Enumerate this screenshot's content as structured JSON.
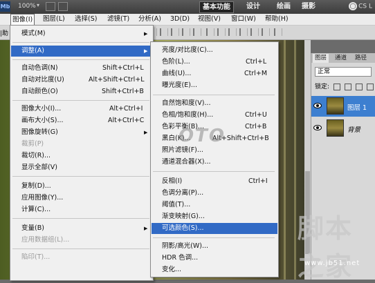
{
  "topbar": {
    "logo": "Mb",
    "zoom": "100%",
    "workspaces": [
      "基本功能",
      "设计",
      "绘画",
      "摄影"
    ],
    "cslive": "CS L"
  },
  "menubar": {
    "items": [
      "图像(I)",
      "图层(L)",
      "选择(S)",
      "滤镜(T)",
      "分析(A)",
      "3D(D)",
      "视图(V)",
      "窗口(W)",
      "帮助(H)"
    ],
    "left_clip": "|助"
  },
  "image_menu": {
    "items": [
      {
        "label": "模式(M)",
        "shortcut": "",
        "arrow": true
      },
      {
        "label": "调整(A)",
        "shortcut": "",
        "arrow": true
      },
      {
        "label": "自动色调(N)",
        "shortcut": "Shift+Ctrl+L"
      },
      {
        "label": "自动对比度(U)",
        "shortcut": "Alt+Shift+Ctrl+L"
      },
      {
        "label": "自动颜色(O)",
        "shortcut": "Shift+Ctrl+B"
      },
      {
        "label": "图像大小(I)...",
        "shortcut": "Alt+Ctrl+I"
      },
      {
        "label": "画布大小(S)...",
        "shortcut": "Alt+Ctrl+C"
      },
      {
        "label": "图像旋转(G)",
        "shortcut": "",
        "arrow": true
      },
      {
        "label": "裁剪(P)",
        "shortcut": "",
        "disabled": true
      },
      {
        "label": "裁切(R)...",
        "shortcut": ""
      },
      {
        "label": "显示全部(V)",
        "shortcut": ""
      },
      {
        "label": "复制(D)...",
        "shortcut": ""
      },
      {
        "label": "应用图像(Y)...",
        "shortcut": ""
      },
      {
        "label": "计算(C)...",
        "shortcut": ""
      },
      {
        "label": "变量(B)",
        "shortcut": "",
        "arrow": true
      },
      {
        "label": "应用数据组(L)...",
        "shortcut": "",
        "disabled": true
      },
      {
        "label": "陷印(T)...",
        "shortcut": "",
        "disabled": true
      }
    ]
  },
  "adjust_menu": {
    "items": [
      {
        "label": "亮度/对比度(C)...",
        "shortcut": ""
      },
      {
        "label": "色阶(L)...",
        "shortcut": "Ctrl+L"
      },
      {
        "label": "曲线(U)...",
        "shortcut": "Ctrl+M"
      },
      {
        "label": "曝光度(E)...",
        "shortcut": ""
      },
      {
        "label": "自然饱和度(V)...",
        "shortcut": ""
      },
      {
        "label": "色相/饱和度(H)...",
        "shortcut": "Ctrl+U"
      },
      {
        "label": "色彩平衡(B)...",
        "shortcut": "Ctrl+B"
      },
      {
        "label": "黑白(K)...",
        "shortcut": "Alt+Shift+Ctrl+B"
      },
      {
        "label": "照片滤镜(F)...",
        "shortcut": ""
      },
      {
        "label": "通道混合器(X)...",
        "shortcut": ""
      },
      {
        "label": "反相(I)",
        "shortcut": "Ctrl+I"
      },
      {
        "label": "色调分离(P)...",
        "shortcut": ""
      },
      {
        "label": "阈值(T)...",
        "shortcut": ""
      },
      {
        "label": "渐变映射(G)...",
        "shortcut": ""
      },
      {
        "label": "可选颜色(S)...",
        "shortcut": "",
        "highlighted": true
      },
      {
        "label": "阴影/高光(W)...",
        "shortcut": ""
      },
      {
        "label": "HDR 色调...",
        "shortcut": ""
      },
      {
        "label": "变化...",
        "shortcut": ""
      }
    ]
  },
  "layers_panel": {
    "tabs": [
      "图层",
      "通道",
      "路径"
    ],
    "blend_mode": "正常",
    "lock_label": "锁定:",
    "layers": [
      {
        "name": "图层 1",
        "selected": true
      },
      {
        "name": "背景",
        "selected": false
      }
    ]
  },
  "watermarks": {
    "oto": "OTO",
    "site": "脚本之家",
    "site_small": "www.jb51.net"
  },
  "colors": {
    "highlight": "#316ac5",
    "layer_selected": "#3d7fd0"
  }
}
